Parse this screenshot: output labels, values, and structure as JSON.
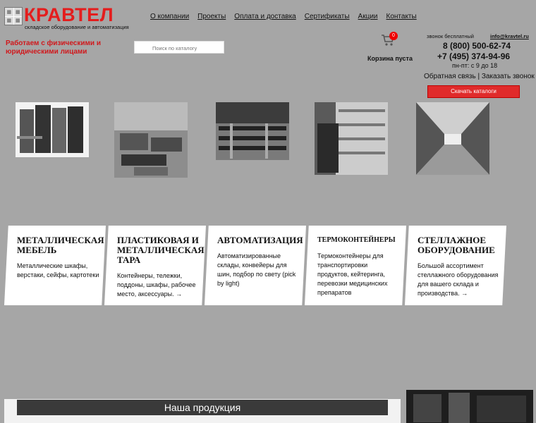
{
  "logo": {
    "word": "КРАВТЕЛ",
    "tagline": "складское оборудование и автоматизация",
    "mark": [
      "▦",
      "▦",
      "▦",
      "▦"
    ]
  },
  "nav": {
    "items": [
      {
        "label": "О компании"
      },
      {
        "label": "Проекты"
      },
      {
        "label": "Оплата и доставка"
      },
      {
        "label": "Сертификаты"
      },
      {
        "label": "Акции"
      },
      {
        "label": "Контакты"
      }
    ]
  },
  "tagline": "Работаем с физическими и юридическими лицами",
  "search": {
    "placeholder": "Поиск по каталогу"
  },
  "cart": {
    "count": "0",
    "status": "Корзина пуста",
    "icon": "cart-icon"
  },
  "contacts": {
    "call_label": "звонок бесплатный",
    "email": "info@kravtel.ru",
    "phone1": "8 (800) 500-62-74",
    "phone2": "+7 (495) 374-94-96",
    "hours": "пн-пт: с 9 до 18",
    "callback": "Обратная связь | Заказать звонок",
    "download": "Скачать каталоги"
  },
  "cards": [
    {
      "title": "Металлическая мебель",
      "text": "Металлические шкафы, верстаки, сейфы, картотеки"
    },
    {
      "title": "Пластиковая и металлическая тара",
      "text": "Контейнеры, тележки, поддоны, шкафы, рабочее место, аксессуары. →"
    },
    {
      "title": "Автоматизация",
      "text": "Автоматизированные склады, конвейеры для шин, подбор по свету (pick by light)"
    },
    {
      "title": "Термоконтейнеры",
      "text": "Термоконтейнеры для транспортировки продуктов, кейтеринга, перевозки медицинских препаратов"
    },
    {
      "title": "Стеллажное оборудование",
      "text": "Большой ассортимент стеллажного оборудования для вашего склада и производства. →"
    }
  ],
  "products": {
    "heading": "Наша продукция"
  },
  "colors": {
    "accent": "#e02b2b",
    "brand": "#e41d1d",
    "background": "#a6a6a6"
  }
}
